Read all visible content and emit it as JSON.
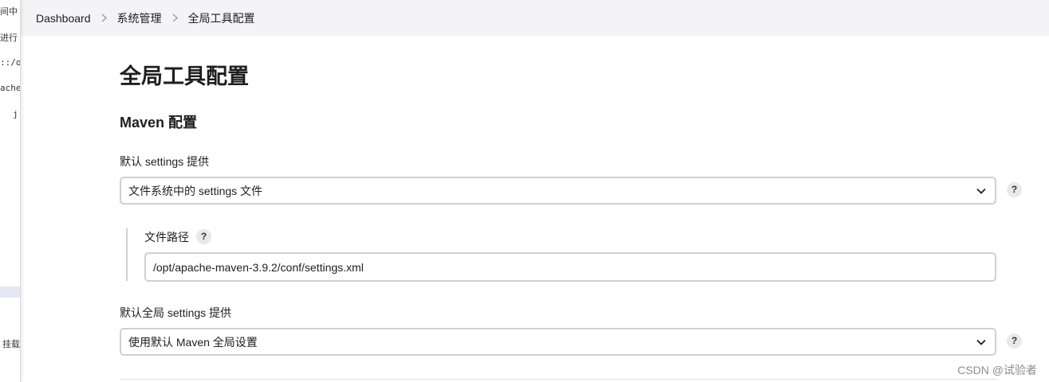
{
  "background_window": {
    "fragments": [
      "间中",
      "进行",
      "::/op",
      "ache-",
      "j(",
      "挂载"
    ]
  },
  "breadcrumb": {
    "items": [
      "Dashboard",
      "系统管理",
      "全局工具配置"
    ]
  },
  "page": {
    "title": "全局工具配置",
    "section_title": "Maven 配置"
  },
  "settings": {
    "label": "默认 settings 提供",
    "selected": "文件系统中的 settings 文件",
    "file_path": {
      "label": "文件路径",
      "value": "/opt/apache-maven-3.9.2/conf/settings.xml"
    }
  },
  "global_settings": {
    "label": "默认全局 settings 提供",
    "selected": "使用默认 Maven 全局设置"
  },
  "help_symbol": "?",
  "watermark": "CSDN @试验者",
  "colors": {
    "breadcrumb_bg": "#f4f4f6",
    "border": "#cfd0d6",
    "help_bg": "#e9e9ec"
  }
}
